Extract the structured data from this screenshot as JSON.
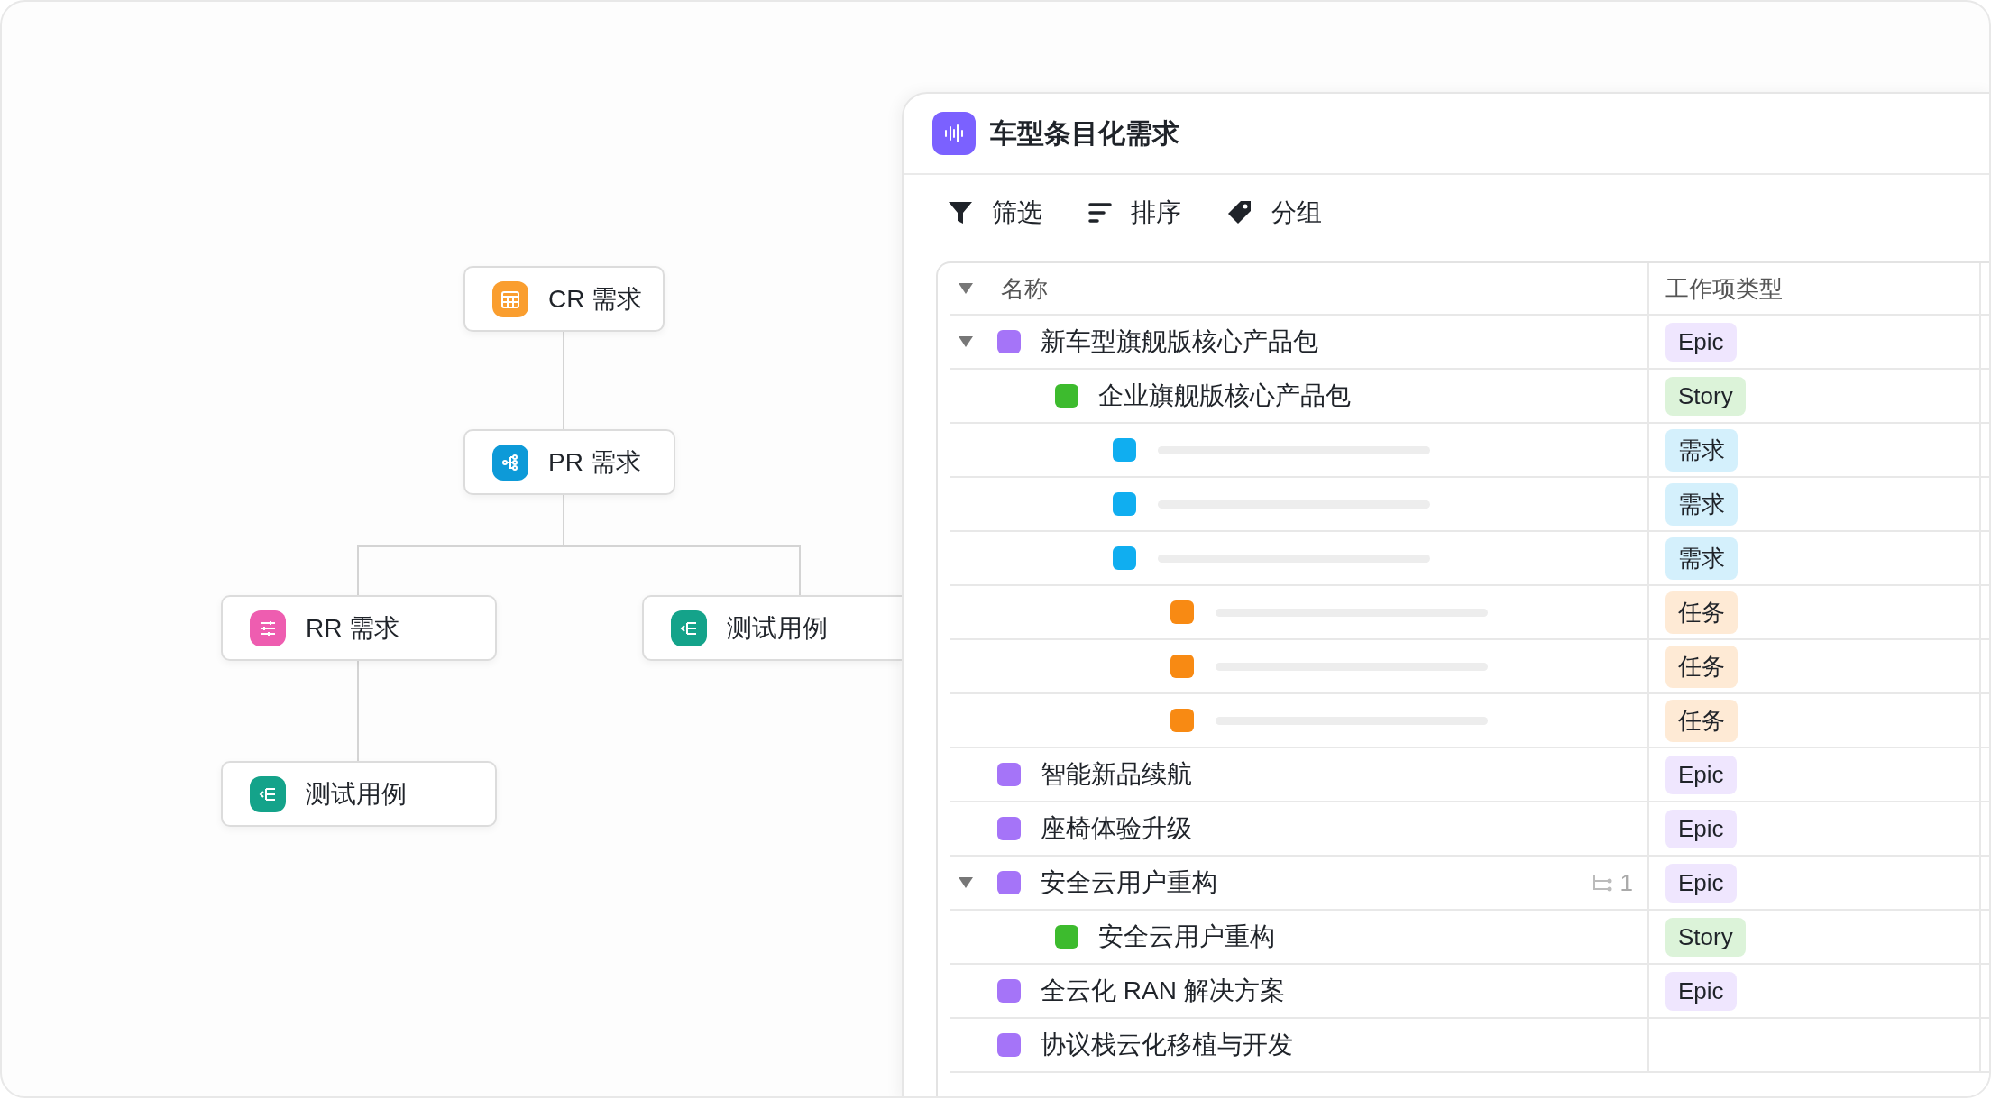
{
  "diagram": {
    "nodes": [
      {
        "label": "CR 需求",
        "kind": "cr",
        "color": "#fa9e2f"
      },
      {
        "label": "PR 需求",
        "kind": "pr",
        "color": "#0d9ad8"
      },
      {
        "label": "RR 需求",
        "kind": "rr",
        "color": "#ee5db0"
      },
      {
        "label": "测试用例",
        "kind": "test",
        "color": "#14a38a"
      },
      {
        "label": "测试用例",
        "kind": "test",
        "color": "#14a38a"
      }
    ]
  },
  "panel": {
    "title": "车型条目化需求",
    "toolbar": [
      {
        "label": "筛选",
        "kind": "filter"
      },
      {
        "label": "排序",
        "kind": "sort"
      },
      {
        "label": "分组",
        "kind": "group"
      }
    ],
    "table": {
      "columns": [
        {
          "label": "名称",
          "expanded": true
        },
        {
          "label": "工作项类型"
        }
      ],
      "rows": [
        {
          "kind": "item",
          "name": "新车型旗舰版核心产品包",
          "type": "Epic",
          "color": "#a574f8",
          "expanded": true,
          "children": [
            {
              "kind": "item",
              "name": "企业旗舰版核心产品包",
              "type": "Story",
              "color": "#3dbb2e",
              "children": [
                {
                  "kind": "placeholder",
                  "type": "需求",
                  "color": "#10aef0"
                },
                {
                  "kind": "placeholder",
                  "type": "需求",
                  "color": "#10aef0"
                },
                {
                  "kind": "placeholder",
                  "type": "需求",
                  "color": "#10aef0",
                  "children": [
                    {
                      "kind": "placeholder",
                      "type": "任务",
                      "color": "#f88a13"
                    },
                    {
                      "kind": "placeholder",
                      "type": "任务",
                      "color": "#f88a13"
                    },
                    {
                      "kind": "placeholder",
                      "type": "任务",
                      "color": "#f88a13"
                    }
                  ]
                }
              ]
            }
          ]
        },
        {
          "kind": "item",
          "name": "智能新品续航",
          "type": "Epic",
          "color": "#a574f8"
        },
        {
          "kind": "item",
          "name": "座椅体验升级",
          "type": "Epic",
          "color": "#a574f8"
        },
        {
          "kind": "item",
          "name": "安全云用户重构",
          "type": "Epic",
          "color": "#a574f8",
          "expanded": true,
          "subtasks": "1",
          "children": [
            {
              "kind": "item",
              "name": "安全云用户重构",
              "type": "Story",
              "color": "#3dbb2e"
            }
          ]
        },
        {
          "kind": "item",
          "name": "全云化 RAN 解决方案",
          "type": "Epic",
          "color": "#a574f8"
        },
        {
          "kind": "item",
          "name": "协议栈云化移植与开发",
          "color": "#a574f8"
        }
      ]
    }
  }
}
